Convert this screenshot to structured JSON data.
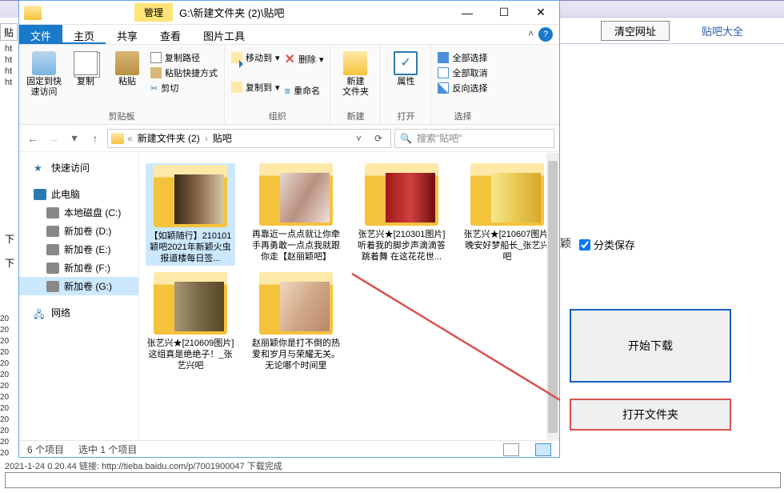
{
  "left": {
    "tab": "贴",
    "lines": "ht\nht\nht\nht",
    "label1": "下",
    "label2": "下",
    "dates": "20\n20\n20\n20\n20\n20\n20\n20\n20\n20\n20\n20\n20"
  },
  "titlebar": {
    "tool_tab": "管理",
    "path": "G:\\新建文件夹 (2)\\贴吧",
    "min": "—",
    "max": "☐",
    "close": "✕"
  },
  "menu": {
    "file": "文件",
    "home": "主页",
    "share": "共享",
    "view": "查看",
    "pictools": "图片工具"
  },
  "ribbon": {
    "pin": "固定到快\n速访问",
    "copy": "复制",
    "paste": "粘贴",
    "copy_path": "复制路径",
    "paste_shortcut": "粘贴快捷方式",
    "cut": "剪切",
    "clipboard": "剪贴板",
    "move_to": "移动到",
    "copy_to": "复制到",
    "delete": "删除",
    "rename": "重命名",
    "organize": "组织",
    "new_folder": "新建\n文件夹",
    "new": "新建",
    "properties": "属性",
    "open": "打开",
    "select_all": "全部选择",
    "select_none": "全部取消",
    "invert": "反向选择",
    "select": "选择"
  },
  "nav": {
    "back": "←",
    "fwd": "→",
    "up": "↑",
    "crumb_sep": "«",
    "crumb1": "新建文件夹 (2)",
    "crumb2": "贴吧",
    "search_placeholder": "搜索\"贴吧\""
  },
  "tree": {
    "quick": "快速访问",
    "pc": "此电脑",
    "c": "本地磁盘 (C:)",
    "d": "新加卷 (D:)",
    "e": "新加卷 (E:)",
    "f": "新加卷 (F:)",
    "g": "新加卷 (G:)",
    "net": "网络"
  },
  "files": [
    {
      "name": "【如颖随行】210101颖吧2021年新颖火虫报道楼每日签...",
      "pic": "pic1",
      "sel": true
    },
    {
      "name": "再靠近一点点就让你牵手再勇敢一点点我就跟你走【赵丽颖吧】",
      "pic": "pic2",
      "sel": false
    },
    {
      "name": "张艺兴★[210301图片]听着我的脚步声滴滴答跳着舞 在这花花世...",
      "pic": "pic3",
      "sel": false
    },
    {
      "name": "张艺兴★[210607图片]晚安好梦船长_张艺兴吧",
      "pic": "pic4",
      "sel": false
    },
    {
      "name": "张艺兴★[210609图片]这组真是绝绝子！_张艺兴吧",
      "pic": "pic5",
      "sel": false
    },
    {
      "name": "赵丽颖你是打不倒的热爱和岁月与荣耀无关。无论哪个时间里",
      "pic": "pic6",
      "sel": false
    }
  ],
  "status": {
    "count": "6 个项目",
    "selected": "选中 1 个项目"
  },
  "right": {
    "clear": "清空网址",
    "all": "贴吧大全",
    "sig": "颖",
    "chk": "分类保存",
    "start": "开始下载",
    "open": "打开文件夹"
  },
  "bottom": "2021-1-24 0.20.44 链接: http://tieba.baidu.com/p/7001900047 下载完成"
}
